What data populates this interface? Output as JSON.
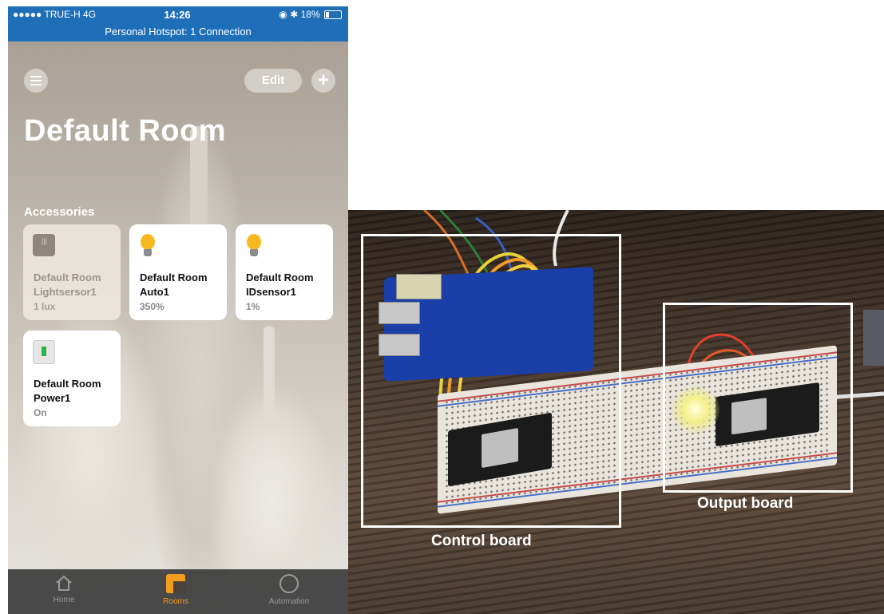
{
  "status_bar": {
    "carrier": "●●●●● TRUE-H  4G",
    "time": "14:26",
    "battery": "18%",
    "hotspot": "Personal Hotspot: 1 Connection"
  },
  "toolbar": {
    "edit_label": "Edit",
    "add_label": "+"
  },
  "room": {
    "title": "Default Room",
    "section_label": "Accessories"
  },
  "accessories": [
    {
      "name_line1": "Default Room",
      "name_line2": "Lightsersor1",
      "status": "1 lux",
      "icon": "light-sensor-icon"
    },
    {
      "name_line1": "Default Room",
      "name_line2": "Auto1",
      "status": "350%",
      "icon": "lightbulb-icon"
    },
    {
      "name_line1": "Default Room",
      "name_line2": "IDsensor1",
      "status": "1%",
      "icon": "lightbulb-icon"
    },
    {
      "name_line1": "Default Room",
      "name_line2": "Power1",
      "status": "On",
      "icon": "outlet-icon"
    }
  ],
  "tabs": [
    {
      "label": "Home",
      "icon": "home-icon",
      "active": false
    },
    {
      "label": "Rooms",
      "icon": "rooms-icon",
      "active": true
    },
    {
      "label": "Automation",
      "icon": "automation-icon",
      "active": false
    }
  ],
  "photo": {
    "control_label": "Control board",
    "output_label": "Output board"
  },
  "colors": {
    "status_bar": "#1f6fb8",
    "accent": "#f39c1f",
    "bulb": "#f6b821"
  }
}
